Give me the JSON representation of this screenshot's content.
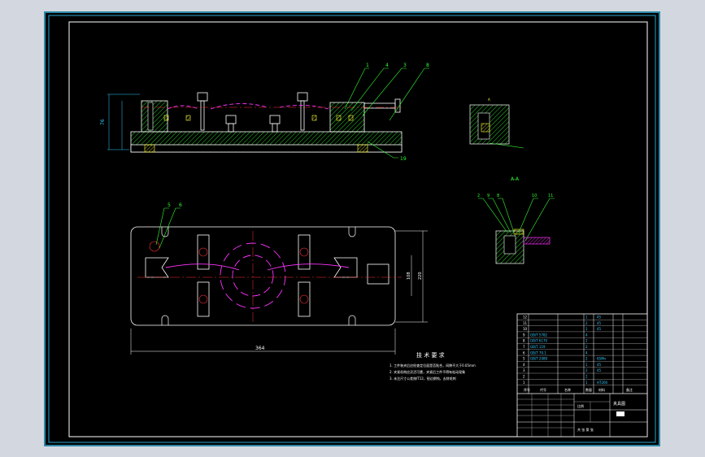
{
  "drawing": {
    "part_numbers_front": [
      "1",
      "4",
      "3",
      "8"
    ],
    "part_number_19": "19",
    "part_numbers_top": [
      "5",
      "6"
    ],
    "dim_height_front": "76",
    "dim_length": "364",
    "dim_width_1": "108",
    "dim_width_2": "220",
    "section_label": "A-A",
    "section_parts": [
      "2",
      "9",
      "8",
      "10",
      "11"
    ]
  },
  "tech_requirements": {
    "title": "技 术 要 求",
    "items": [
      "1. 工件装夹后应检查定位面是否贴合，间隙不大于0.05mm",
      "2. 夹紧机构应灵活可靠，夹紧后工件不得有松动现象",
      "3. 未注尺寸公差按IT12，锐边倒钝，去除毛刺"
    ]
  },
  "bom": {
    "rows": [
      {
        "no": "12",
        "code": "",
        "name": "",
        "qty": "1",
        "mat": "45"
      },
      {
        "no": "11",
        "code": "",
        "name": "",
        "qty": "2",
        "mat": "45"
      },
      {
        "no": "10",
        "code": "",
        "name": "",
        "qty": "1",
        "mat": "45"
      },
      {
        "no": "9",
        "code": "GB/T 5782",
        "name": "",
        "qty": "4",
        "mat": ""
      },
      {
        "no": "8",
        "code": "GB/T 6170",
        "name": "",
        "qty": "2",
        "mat": ""
      },
      {
        "no": "7",
        "code": "GB/T 119",
        "name": "",
        "qty": "2",
        "mat": ""
      },
      {
        "no": "6",
        "code": "GB/T 70.1",
        "name": "",
        "qty": "4",
        "mat": ""
      },
      {
        "no": "5",
        "code": "GB/T 2089",
        "name": "",
        "qty": "2",
        "mat": "65Mn"
      },
      {
        "no": "4",
        "code": "",
        "name": "",
        "qty": "1",
        "mat": "45"
      },
      {
        "no": "3",
        "code": "",
        "name": "",
        "qty": "2",
        "mat": "45"
      },
      {
        "no": "2",
        "code": "",
        "name": "",
        "qty": "2",
        "mat": ""
      },
      {
        "no": "1",
        "code": "",
        "name": "",
        "qty": "1",
        "mat": "HT200"
      }
    ],
    "header": [
      "序号",
      "代号",
      "名称",
      "数量",
      "材料",
      "备注"
    ]
  },
  "title_block": {
    "drawing_name": "夹具图",
    "scale": "比例",
    "sheet": "共 张 第 张"
  },
  "colors": {
    "cyan": "#33ccff",
    "white": "#ffffff",
    "magenta": "#ff33ff",
    "green": "#33ff33",
    "red": "#ff3333",
    "yellow": "#ffff33"
  }
}
